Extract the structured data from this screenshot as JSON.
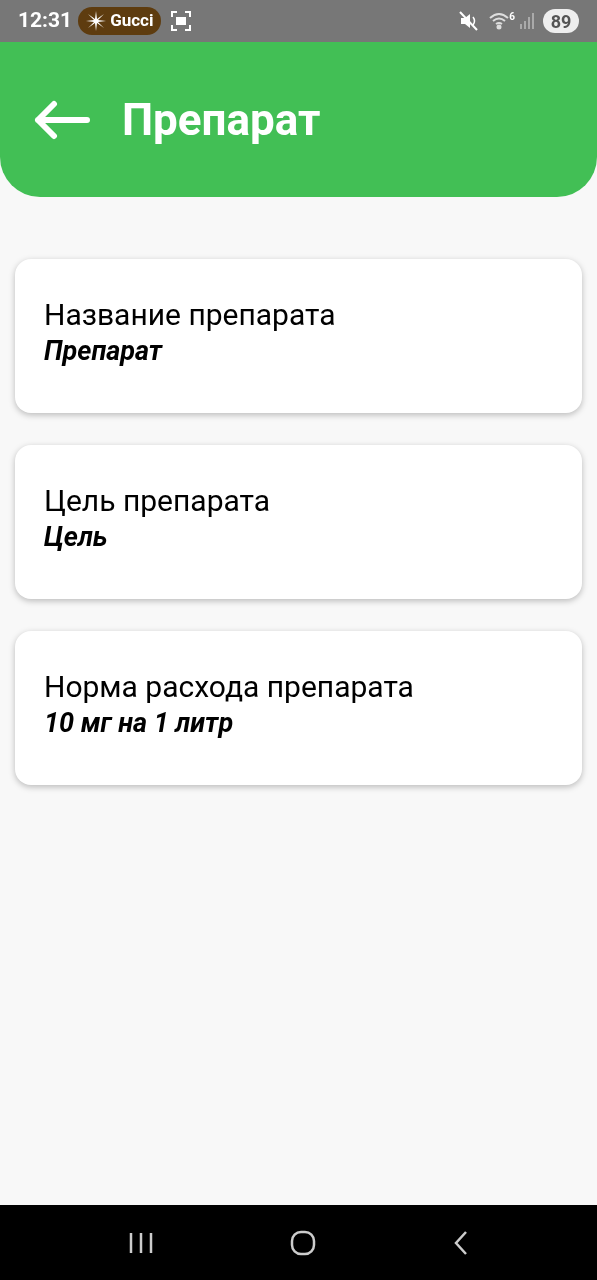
{
  "status_bar": {
    "time": "12:31",
    "pill": "Gucci",
    "wifi_badge": "6",
    "battery": "89"
  },
  "header": {
    "title": "Препарат"
  },
  "fields": [
    {
      "label": "Название препарата",
      "value": "Препарат"
    },
    {
      "label": "Цель препарата",
      "value": "Цель"
    },
    {
      "label": "Норма расхода препарата",
      "value": "10 мг на 1 литр"
    }
  ]
}
